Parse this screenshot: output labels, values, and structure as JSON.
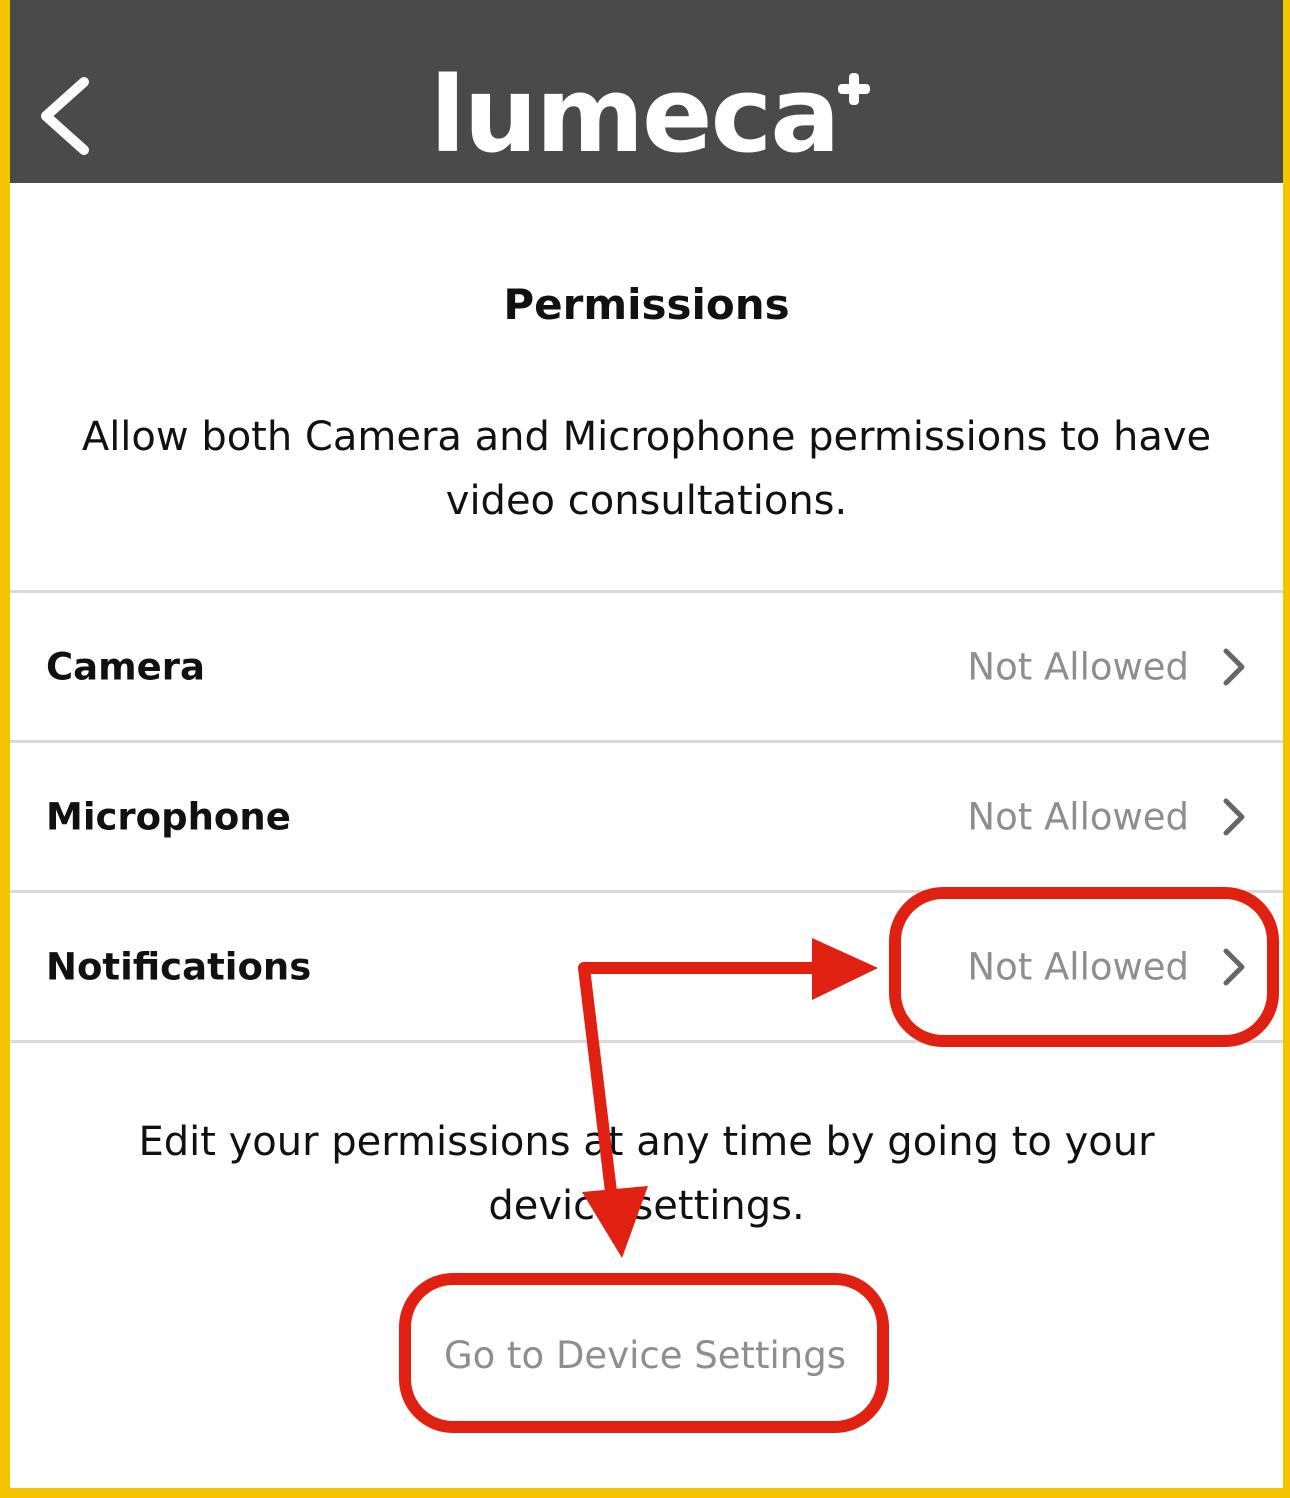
{
  "header": {
    "back_icon": "chevron-left-icon",
    "logo_text": "lumeca",
    "logo_plus_icon": "plus-icon",
    "background": "#4A4A4A"
  },
  "page": {
    "title": "Permissions",
    "intro": "Allow both Camera and Microphone permissions to have video consultations."
  },
  "permissions": [
    {
      "label": "Camera",
      "status": "Not Allowed",
      "chevron_icon": "chevron-right-icon"
    },
    {
      "label": "Microphone",
      "status": "Not Allowed",
      "chevron_icon": "chevron-right-icon"
    },
    {
      "label": "Notifications",
      "status": "Not Allowed",
      "chevron_icon": "chevron-right-icon"
    }
  ],
  "footer": {
    "note": "Edit your permissions at any time by going to your device settings.",
    "device_settings_label": "Go to Device Settings"
  },
  "colors": {
    "border": "#F5C400",
    "annotation": "#E02010",
    "status_text": "#8E8E8E"
  }
}
